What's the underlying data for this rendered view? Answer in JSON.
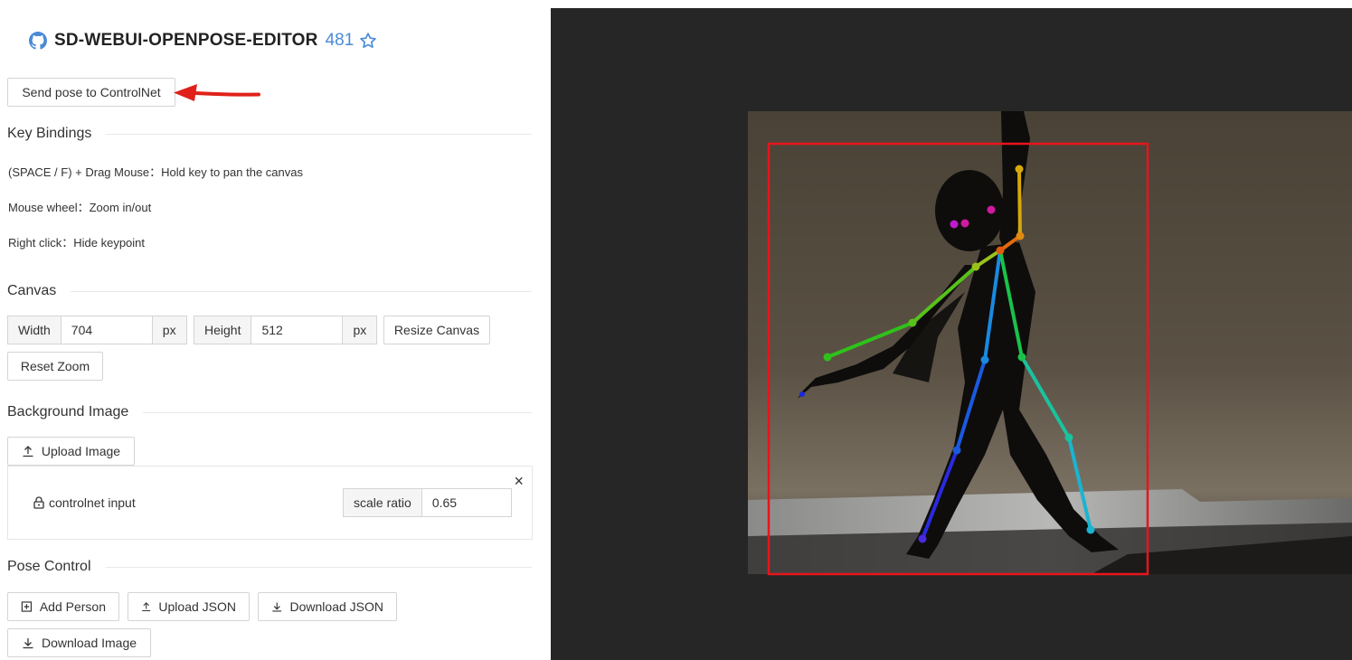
{
  "header": {
    "title": "SD-WEBUI-OPENPOSE-EDITOR",
    "star_count": "481"
  },
  "actions": {
    "send_pose_label": "Send pose to ControlNet"
  },
  "key_bindings": {
    "heading": "Key Bindings",
    "items": [
      "(SPACE / F) + Drag Mouse：Hold key to pan the canvas",
      "Mouse wheel：Zoom in/out",
      "Right click：Hide keypoint"
    ]
  },
  "canvas": {
    "heading": "Canvas",
    "width_label": "Width",
    "width_value": "704",
    "height_label": "Height",
    "height_value": "512",
    "unit": "px",
    "resize_label": "Resize Canvas",
    "reset_zoom_label": "Reset Zoom"
  },
  "background_image": {
    "heading": "Background Image",
    "upload_label": "Upload Image",
    "close_glyph": "×",
    "layer_name": "controlnet input",
    "scale_label": "scale ratio",
    "scale_value": "0.65"
  },
  "pose_control": {
    "heading": "Pose Control",
    "add_person_label": "Add Person",
    "upload_json_label": "Upload JSON",
    "download_json_label": "Download JSON",
    "download_image_label": "Download Image"
  },
  "icons": {
    "github": "github-icon",
    "star": "star-outline-icon",
    "upload": "upload-icon",
    "download": "download-icon",
    "add": "plus-square-icon",
    "lock": "lock-icon",
    "close": "close-icon"
  },
  "colors": {
    "accent_blue": "#4a8ad8",
    "arrow_red": "#e0201a",
    "bbox_red": "#e8141c",
    "canvas_bg": "#262626"
  }
}
